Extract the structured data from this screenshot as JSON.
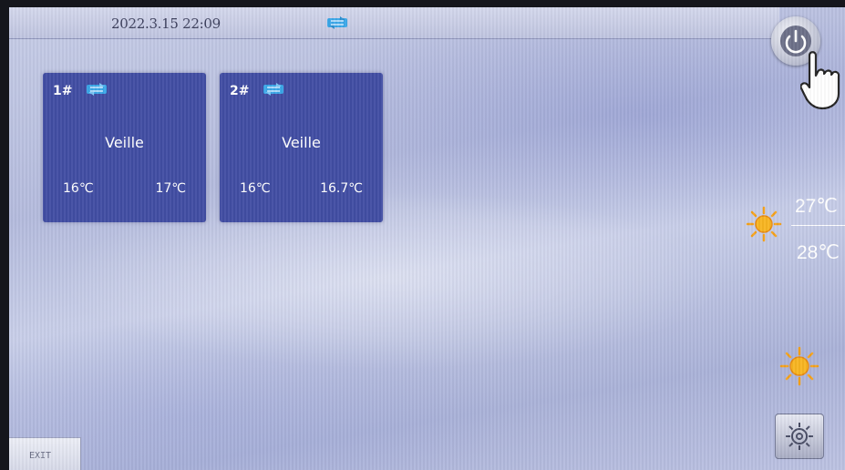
{
  "header": {
    "datetime": "2022.3.15 22:09",
    "status_icon": "ac-mode-icon"
  },
  "units": [
    {
      "id": "1#",
      "icon": "ac-mode-icon",
      "status": "Veille",
      "temp_a": "16℃",
      "temp_b": "17℃"
    },
    {
      "id": "2#",
      "icon": "ac-mode-icon",
      "status": "Veille",
      "temp_a": "16℃",
      "temp_b": "16.7℃"
    }
  ],
  "weather": {
    "icon": "sun-icon",
    "high": "27℃",
    "low": "28℃"
  },
  "controls": {
    "power_icon": "power-icon",
    "settings_icon": "gear-icon",
    "exit_label": "EXIT"
  },
  "colors": {
    "unit_card": "#414da3",
    "accent_icon": "#3aa7e8",
    "sun": "#f6a21a"
  }
}
